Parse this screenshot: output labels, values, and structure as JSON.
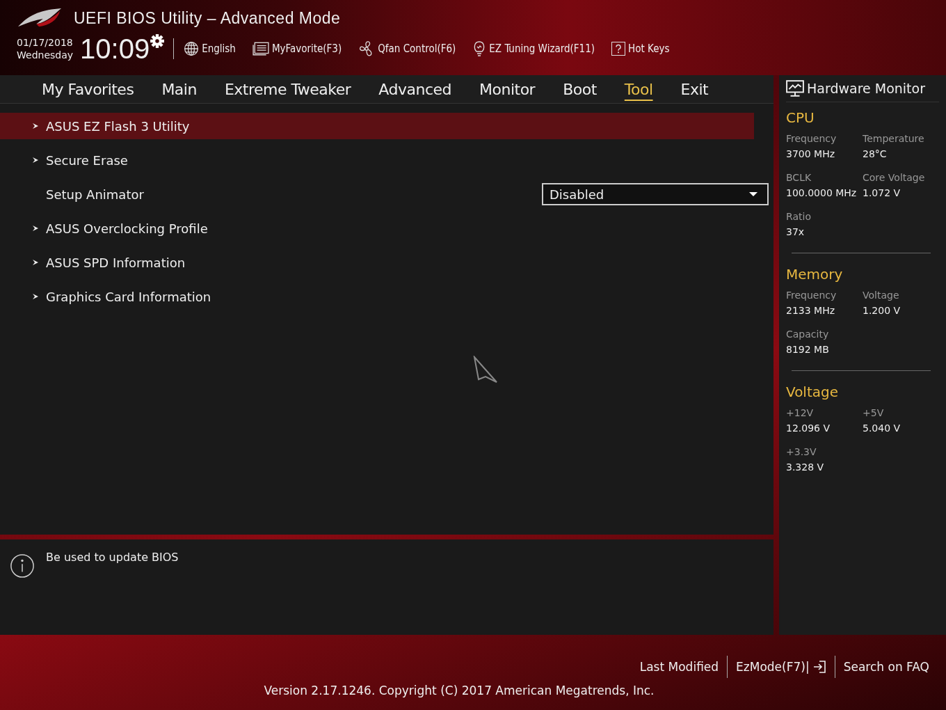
{
  "header": {
    "title": "UEFI BIOS Utility – Advanced Mode",
    "date": "01/17/2018",
    "weekday": "Wednesday",
    "time": "10:09",
    "tools": [
      {
        "kind": "language",
        "label": "English"
      },
      {
        "kind": "favorite",
        "label": "MyFavorite(F3)"
      },
      {
        "kind": "fan",
        "label": "Qfan Control(F6)"
      },
      {
        "kind": "wizard",
        "label": "EZ Tuning Wizard(F11)"
      },
      {
        "kind": "help",
        "label": "Hot Keys"
      }
    ]
  },
  "tabs": [
    {
      "label": "My Favorites",
      "selected": false
    },
    {
      "label": "Main",
      "selected": false
    },
    {
      "label": "Extreme Tweaker",
      "selected": false
    },
    {
      "label": "Advanced",
      "selected": false
    },
    {
      "label": "Monitor",
      "selected": false
    },
    {
      "label": "Boot",
      "selected": false
    },
    {
      "label": "Tool",
      "selected": true
    },
    {
      "label": "Exit",
      "selected": false
    }
  ],
  "items": [
    {
      "kind": "submenu",
      "label": "ASUS EZ Flash 3 Utility",
      "selected": true
    },
    {
      "kind": "submenu",
      "label": "Secure Erase",
      "selected": false
    },
    {
      "kind": "setting",
      "label": "Setup Animator",
      "value": "Disabled",
      "selected": false
    },
    {
      "kind": "submenu",
      "label": "ASUS Overclocking Profile",
      "selected": false
    },
    {
      "kind": "submenu",
      "label": "ASUS SPD Information",
      "selected": false
    },
    {
      "kind": "submenu",
      "label": "Graphics Card Information",
      "selected": false
    }
  ],
  "help_text": "Be used to update BIOS",
  "hardware_monitor": {
    "title": "Hardware Monitor",
    "sections": [
      {
        "title": "CPU",
        "readings": [
          {
            "label": "Frequency",
            "value": "3700 MHz"
          },
          {
            "label": "Temperature",
            "value": "28°C"
          },
          {
            "label": "BCLK",
            "value": "100.0000 MHz"
          },
          {
            "label": "Core Voltage",
            "value": "1.072 V"
          },
          {
            "label": "Ratio",
            "value": "37x"
          }
        ]
      },
      {
        "title": "Memory",
        "readings": [
          {
            "label": "Frequency",
            "value": "2133 MHz"
          },
          {
            "label": "Voltage",
            "value": "1.200 V"
          },
          {
            "label": "Capacity",
            "value": "8192 MB"
          }
        ]
      },
      {
        "title": "Voltage",
        "readings": [
          {
            "label": "+12V",
            "value": "12.096 V"
          },
          {
            "label": "+5V",
            "value": "5.040 V"
          },
          {
            "label": "+3.3V",
            "value": "3.328 V"
          }
        ]
      }
    ]
  },
  "footer": {
    "links": [
      {
        "kind": "plain",
        "label": "Last Modified"
      },
      {
        "kind": "exit",
        "label": "EzMode(F7)|"
      },
      {
        "kind": "plain",
        "label": "Search on FAQ"
      }
    ],
    "version": "Version 2.17.1246. Copyright (C) 2017 American Megatrends, Inc."
  }
}
